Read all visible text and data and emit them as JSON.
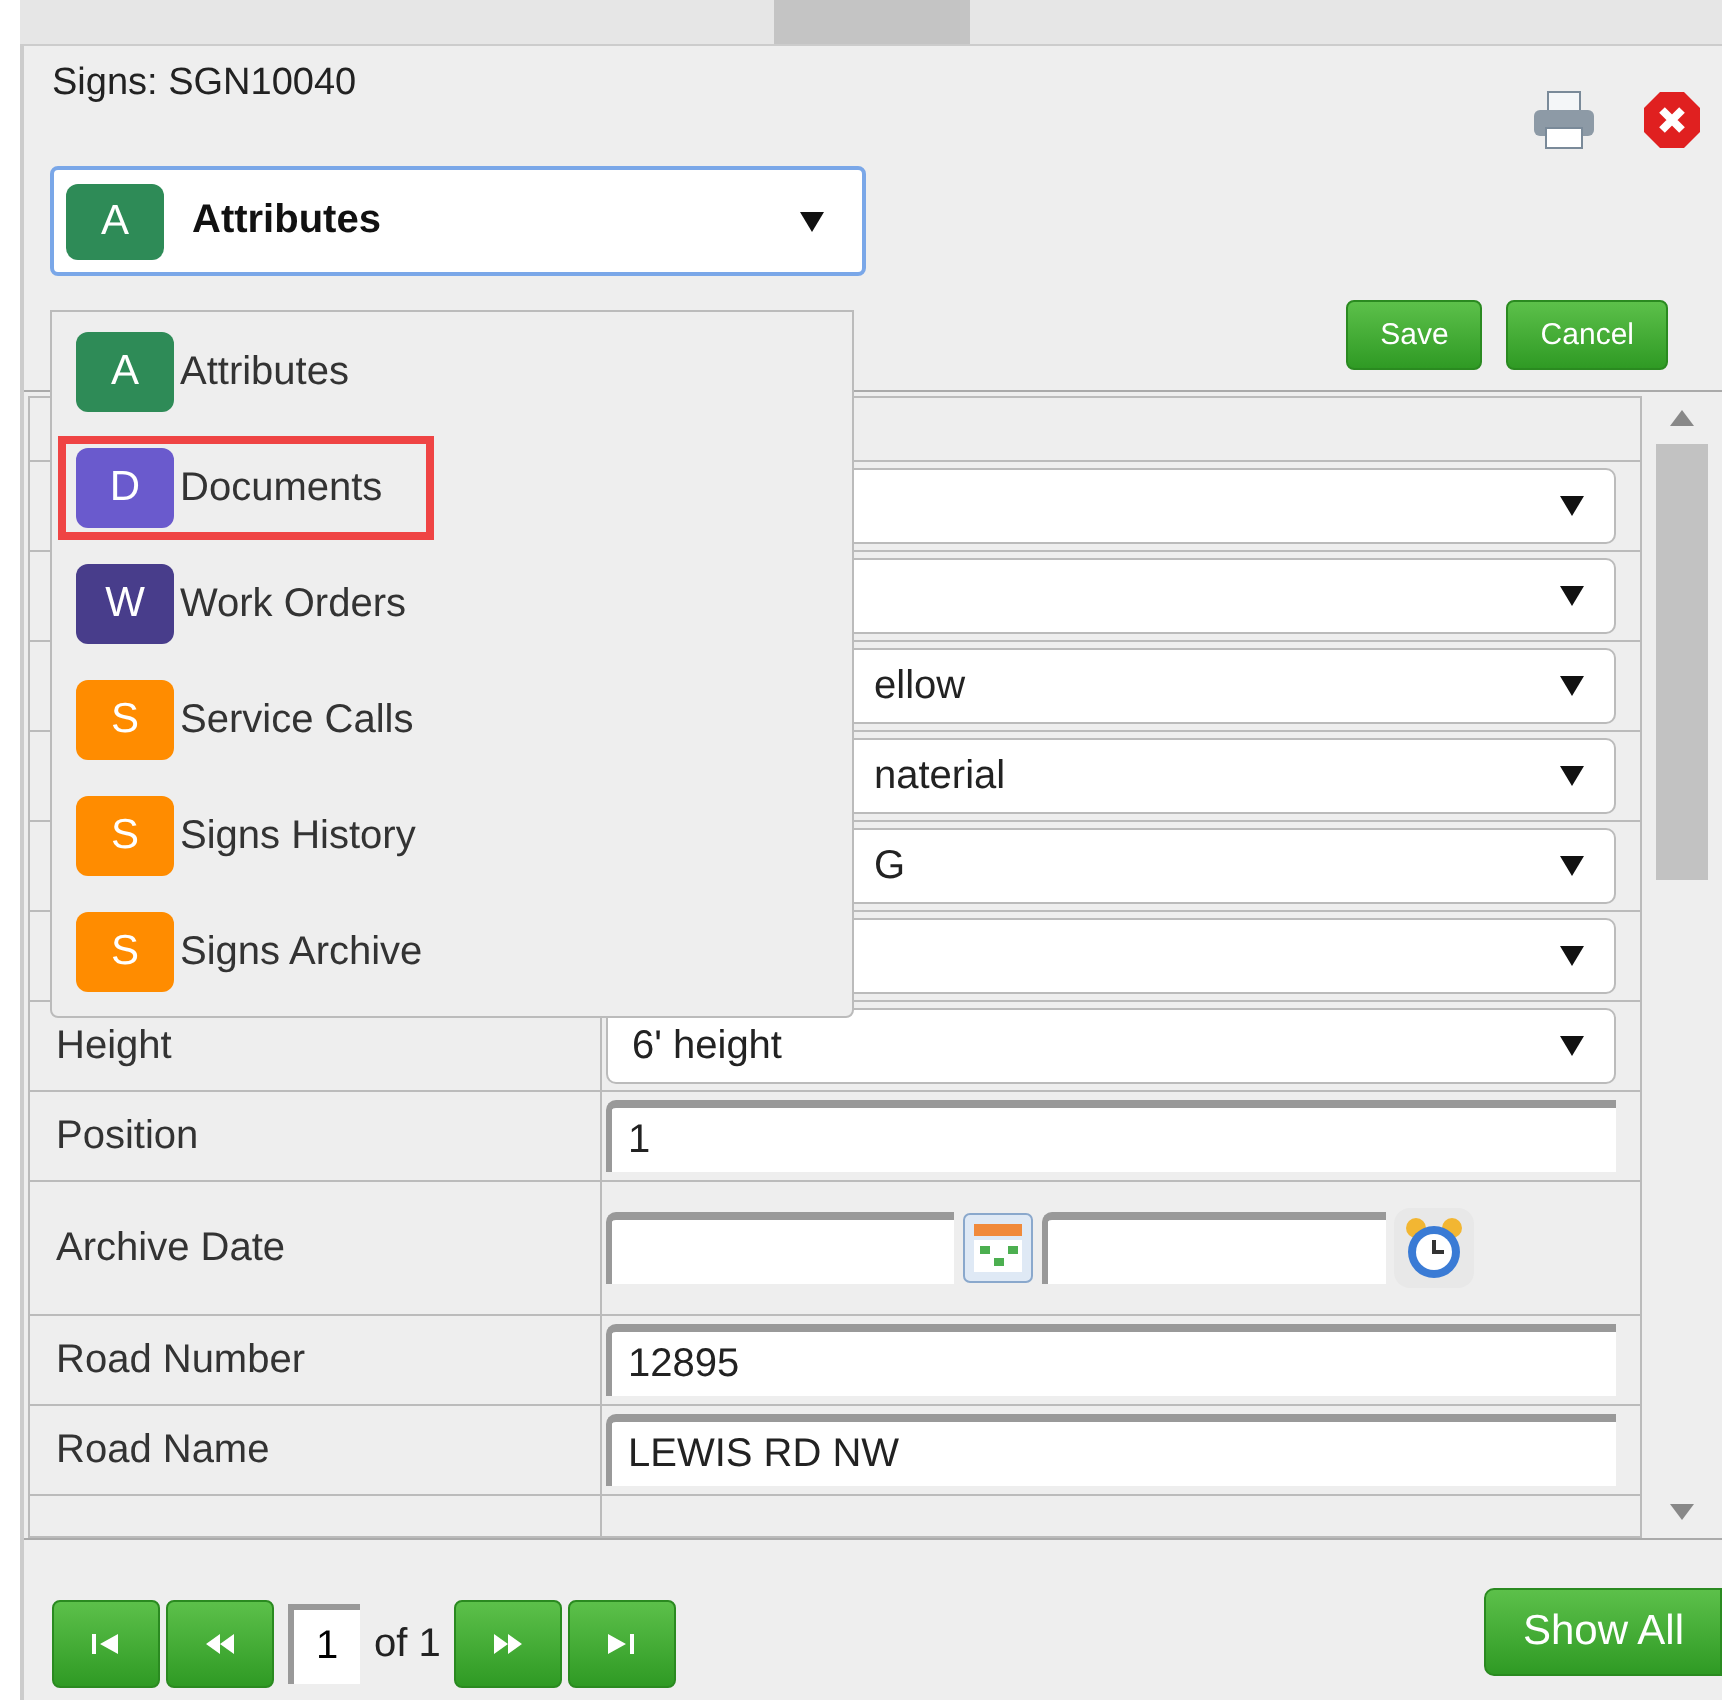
{
  "panel": {
    "title": "Signs: SGN10040"
  },
  "selector": {
    "letter": "A",
    "label": "Attributes",
    "color": "#2e8b57",
    "expanded": true
  },
  "menu": [
    {
      "letter": "A",
      "label": "Attributes",
      "color": "#2e8b57",
      "selected": false
    },
    {
      "letter": "D",
      "label": "Documents",
      "color": "#6a5acd",
      "selected": true
    },
    {
      "letter": "W",
      "label": "Work Orders",
      "color": "#483d8b",
      "selected": false
    },
    {
      "letter": "S",
      "label": "Service Calls",
      "color": "#ff8c00",
      "selected": false
    },
    {
      "letter": "S",
      "label": "Signs History",
      "color": "#ff8c00",
      "selected": false
    },
    {
      "letter": "S",
      "label": "Signs Archive",
      "color": "#ff8c00",
      "selected": false
    }
  ],
  "actions": [
    "Save",
    "Cancel"
  ],
  "rows": [
    {
      "kind": "header"
    },
    {
      "kind": "select",
      "value": ""
    },
    {
      "kind": "select",
      "value": ""
    },
    {
      "kind": "select",
      "value": "ellow"
    },
    {
      "kind": "select",
      "value": "naterial"
    },
    {
      "kind": "select",
      "value": "G"
    },
    {
      "kind": "select",
      "value": ""
    },
    {
      "kind": "select",
      "label": "Height",
      "value": "6' height"
    },
    {
      "kind": "text",
      "label": "Position",
      "value": "1"
    },
    {
      "kind": "datetime",
      "label": "Archive Date"
    },
    {
      "kind": "text",
      "label": "Road Number",
      "value": "12895"
    },
    {
      "kind": "text",
      "label": "Road Name",
      "value": "LEWIS RD NW"
    },
    {
      "kind": "cut"
    }
  ],
  "pager": {
    "page": "1",
    "of": "of 1"
  },
  "show_all": "Show All"
}
